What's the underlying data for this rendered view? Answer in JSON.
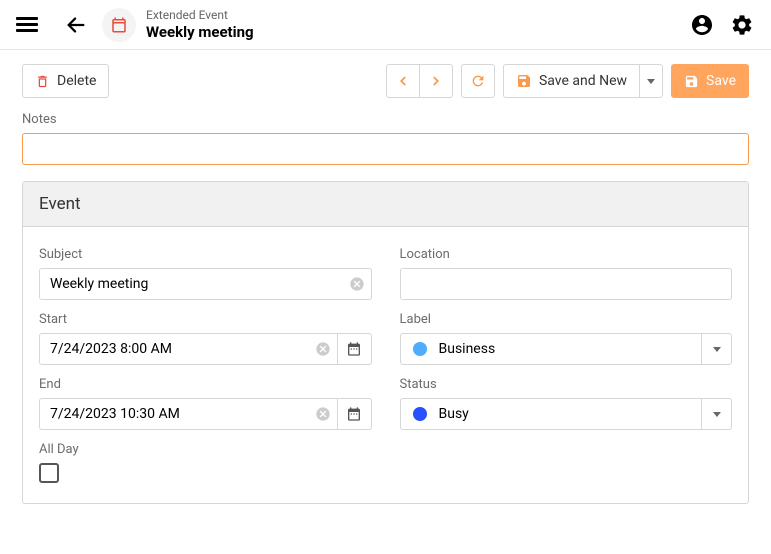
{
  "header": {
    "supertitle": "Extended Event",
    "title": "Weekly meeting"
  },
  "toolbar": {
    "delete_label": "Delete",
    "save_new_label": "Save and New",
    "save_label": "Save"
  },
  "notes": {
    "label": "Notes",
    "value": ""
  },
  "panel": {
    "title": "Event"
  },
  "fields": {
    "subject": {
      "label": "Subject",
      "value": "Weekly meeting"
    },
    "location": {
      "label": "Location",
      "value": ""
    },
    "start": {
      "label": "Start",
      "value": "7/24/2023 8:00 AM"
    },
    "end": {
      "label": "End",
      "value": "7/24/2023 10:30 AM"
    },
    "label": {
      "label": "Label",
      "value": "Business",
      "color": "#4dadff"
    },
    "status": {
      "label": "Status",
      "value": "Busy",
      "color": "#2850ff"
    },
    "allday": {
      "label": "All Day",
      "checked": false
    }
  }
}
